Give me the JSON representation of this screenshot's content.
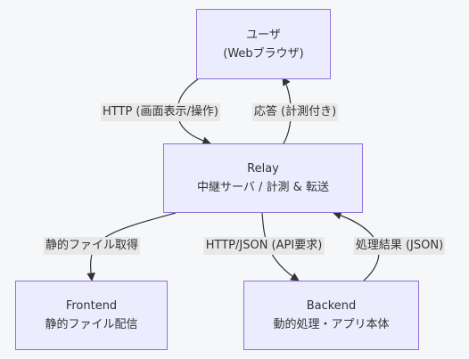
{
  "nodes": {
    "user": {
      "line1": "ユーザ",
      "line2": "(Webブラウザ)"
    },
    "relay": {
      "line1": "Relay",
      "line2": "中継サーバ / 計測 & 転送"
    },
    "frontend": {
      "line1": "Frontend",
      "line2": "静的ファイル配信"
    },
    "backend": {
      "line1": "Backend",
      "line2": "動的処理・アプリ本体"
    }
  },
  "edges": {
    "user_to_relay": "HTTP (画面表示/操作)",
    "relay_to_user": "応答 (計測付き)",
    "relay_to_frontend": "静的ファイル取得",
    "relay_to_backend": "HTTP/JSON (API要求)",
    "backend_to_relay": "処理結果 (JSON)"
  },
  "colors": {
    "node_fill": "#ececff",
    "node_border": "#9370db",
    "edge": "#333333",
    "label_bg": "#e8e8e8",
    "background": "#f6f7f9"
  }
}
